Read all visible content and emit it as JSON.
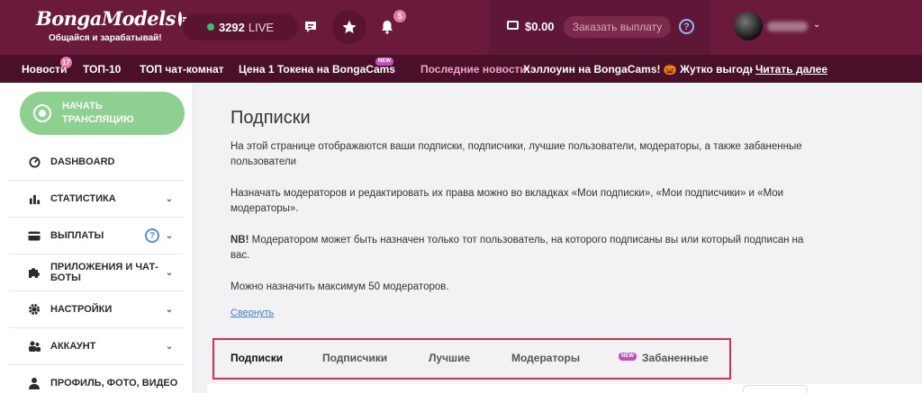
{
  "header": {
    "logo": "BongaModels",
    "tagline": "Общайся и зарабатывай!",
    "live_count": "3292",
    "live_label": "LIVE",
    "notifications_count": "5",
    "balance": "$0.00",
    "payout_button": "Заказать выплату",
    "help": "?"
  },
  "subnav": {
    "news": "Новости",
    "news_count": "17",
    "top10": "ТОП-10",
    "top_rooms": "ТОП чат-комнат",
    "token_price": "Цена 1 Токена на BongaCams",
    "new_badge": "NEW",
    "latest_label": "Последние новости:",
    "latest_text": "Хэллоуин на BongaCams! 🎃 Жутко выгодное в",
    "read_more": "Читать далее"
  },
  "sidebar": {
    "start_button": "НАЧАТЬ ТРАНСЛЯЦИЮ",
    "items": [
      {
        "label": "DASHBOARD"
      },
      {
        "label": "СТАТИСТИКА"
      },
      {
        "label": "ВЫПЛАТЫ"
      },
      {
        "label": "ПРИЛОЖЕНИЯ И ЧАТ-БОТЫ"
      },
      {
        "label": "НАСТРОЙКИ"
      },
      {
        "label": "АККАУНТ"
      },
      {
        "label": "ПРОФИЛЬ, ФОТО, ВИДЕО"
      }
    ],
    "help": "?"
  },
  "main": {
    "title": "Подписки",
    "paragraph1": "На этой странице отображаются ваши подписки, подписчики, лучшие пользователи, модераторы, а также забаненные пользователи",
    "paragraph2": "Назначать модераторов и редактировать их права можно во вкладках «Мои подписки», «Мои подписчики» и «Мои модераторы».",
    "nb_label": "NB!",
    "paragraph3": " Модератором может быть назначен только тот пользователь, на которого подписаны вы или который подписан на вас.",
    "paragraph4": "Можно назначить максимум 50 модераторов.",
    "collapse": "Свернуть",
    "tabs": [
      {
        "label": "Подписки"
      },
      {
        "label": "Подписчики"
      },
      {
        "label": "Лучшие"
      },
      {
        "label": "Модераторы"
      },
      {
        "label": "Забаненные",
        "badge": "NEW"
      }
    ]
  },
  "colors": {
    "header_bg": "#6b1a3c",
    "subnav_bg": "#4a1029",
    "start_button": "#8ed08f",
    "highlight_border": "#d32f4f"
  }
}
